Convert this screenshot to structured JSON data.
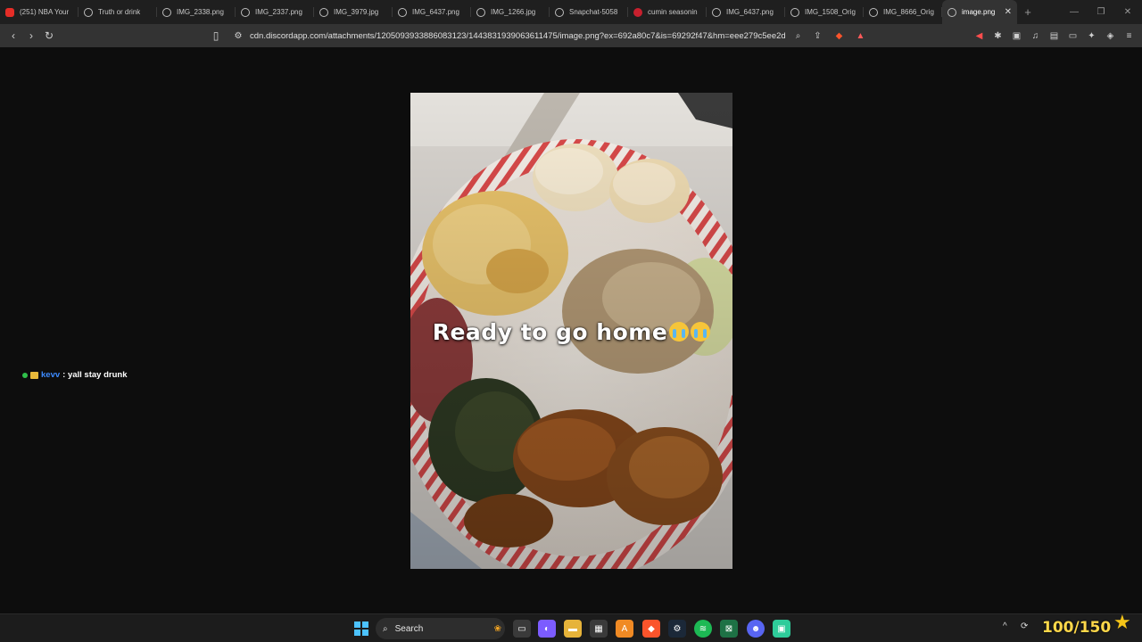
{
  "tabs": [
    {
      "title": "(251) NBA Your",
      "icon": "youtube-icon"
    },
    {
      "title": "Truth or drink",
      "icon": "globe-icon"
    },
    {
      "title": "IMG_2338.png",
      "icon": "globe-icon"
    },
    {
      "title": "IMG_2337.png",
      "icon": "globe-icon"
    },
    {
      "title": "IMG_3979.jpg",
      "icon": "globe-icon"
    },
    {
      "title": "IMG_6437.png",
      "icon": "globe-icon"
    },
    {
      "title": "IMG_1266.jpg",
      "icon": "globe-icon"
    },
    {
      "title": "Snapchat-5058",
      "icon": "globe-icon"
    },
    {
      "title": "cumin seasonin",
      "icon": "pinterest-icon"
    },
    {
      "title": "IMG_6437.png",
      "icon": "globe-icon"
    },
    {
      "title": "IMG_1508_Orig",
      "icon": "globe-icon"
    },
    {
      "title": "IMG_8666_Orig",
      "icon": "globe-icon"
    },
    {
      "title": "image.png",
      "icon": "globe-icon",
      "active": true
    }
  ],
  "toolbar": {
    "url": "cdn.discordapp.com/attachments/1205093933886083123/1443831939063611475/image.png?ex=692a80c7&is=69292f47&hm=eee279c5ee2d..."
  },
  "image": {
    "caption": "Ready to go home"
  },
  "chat": {
    "user": "kevv",
    "message": ": yall stay drunk"
  },
  "taskbar": {
    "search_label": "Search",
    "counter": "100/150"
  },
  "colors": {
    "accent_blue": "#3d8bff",
    "counter_yellow": "#ffd84a",
    "brave_orange": "#fb542b"
  }
}
